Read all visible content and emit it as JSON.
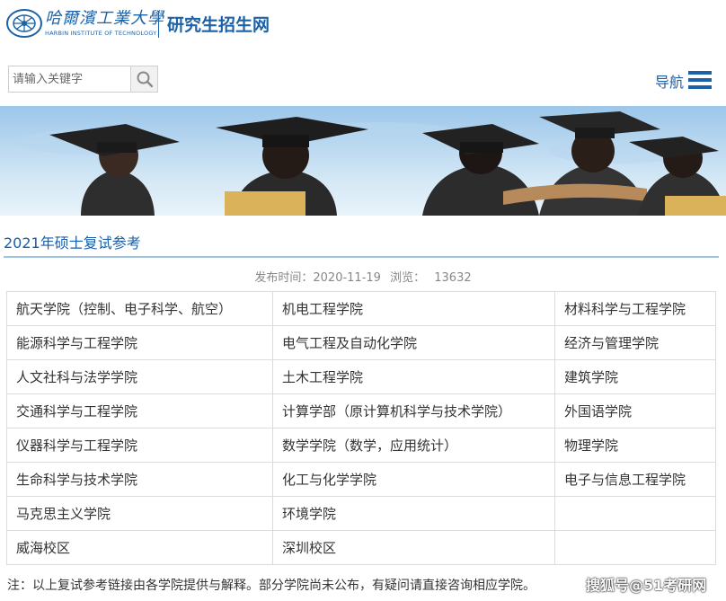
{
  "header": {
    "logo_cn": "哈爾濱工業大學",
    "logo_en": "HARBIN INSTITUTE OF TECHNOLOGY",
    "site_title": "研究生招生网",
    "brand_color": "#1b62a8"
  },
  "search": {
    "placeholder": "请输入关键字",
    "button_icon": "search-icon"
  },
  "nav": {
    "label": "导航",
    "icon": "menu-icon"
  },
  "banner": {
    "image": "graduates-with-caps-photo"
  },
  "article": {
    "title": "2021年硕士复试参考",
    "publish_label": "发布时间：2020-11-19",
    "views_label": "浏览：",
    "views_count": "13632"
  },
  "schools": [
    [
      "航天学院（控制、电子科学、航空）",
      "机电工程学院",
      "材料科学与工程学院"
    ],
    [
      "能源科学与工程学院",
      "电气工程及自动化学院",
      "经济与管理学院"
    ],
    [
      "人文社科与法学学院",
      "土木工程学院",
      "建筑学院"
    ],
    [
      "交通科学与工程学院",
      "计算学部（原计算机科学与技术学院）",
      "外国语学院"
    ],
    [
      "仪器科学与工程学院",
      "数学学院（数学，应用统计）",
      "物理学院"
    ],
    [
      "生命科学与技术学院",
      "化工与化学学院",
      "电子与信息工程学院"
    ],
    [
      "马克思主义学院",
      "环境学院",
      ""
    ],
    [
      "威海校区",
      "深圳校区",
      ""
    ]
  ],
  "note": "注：以上复试参考链接由各学院提供与解释。部分学院尚未公布，有疑问请直接咨询相应学院。",
  "watermark": "搜狐号@51考研网"
}
